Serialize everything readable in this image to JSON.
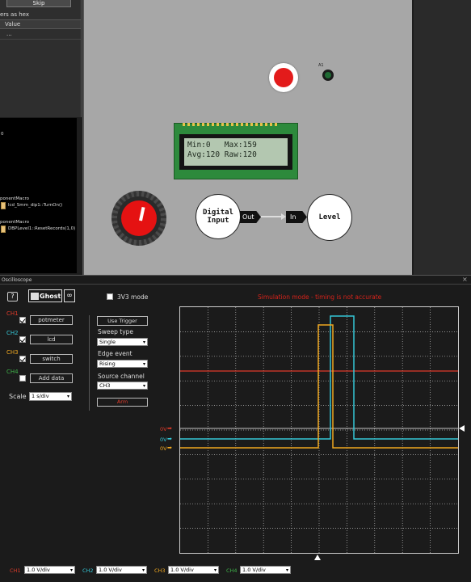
{
  "sim": {
    "skip_label": "Skip",
    "hex_label": "ers as hex",
    "value_header": "Value",
    "value_row": "...",
    "left_items": [
      {
        "text": "0"
      },
      {
        "text": "ponentMacro"
      },
      {
        "text": "lcd_Smm_dip1::TurnOn()"
      },
      {
        "text": "ponentMacro"
      },
      {
        "text": "DBPLevel1::ResetRecords(1,0)"
      }
    ]
  },
  "canvas": {
    "led_label": "A1",
    "lcd_line1": "Min:0   Max:159",
    "lcd_line2": "Avg:120 Raw:120",
    "digital_input": "Digital Input",
    "out_label": "Out",
    "in_label": "In",
    "level_label": "Level"
  },
  "scope": {
    "title": "Oscilloscope",
    "ghost_label": "Ghost",
    "mode_3v3": "3V3 mode",
    "warning": "Simulation mode - timing is not accurate",
    "channels": [
      {
        "id": "CH1",
        "name": "potmeter",
        "checked": true,
        "color": "#e03b2a"
      },
      {
        "id": "CH2",
        "name": "lcd",
        "checked": true,
        "color": "#35c8d8"
      },
      {
        "id": "CH3",
        "name": "switch",
        "checked": true,
        "color": "#f0a820"
      },
      {
        "id": "CH4",
        "name": "Add data",
        "checked": false,
        "color": "#3fb24a"
      }
    ],
    "scale_label": "Scale",
    "scale_value": "1 s/div",
    "trigger_btn": "Use Trigger",
    "sweep_label": "Sweep type",
    "sweep_value": "Single",
    "edge_label": "Edge event",
    "edge_value": "Rising",
    "source_label": "Source channel",
    "source_value": "CH3",
    "arm_btn": "Arm",
    "zero_labels": [
      "0V",
      "0V",
      "0V"
    ],
    "vdiv": [
      {
        "id": "CH1",
        "value": "1.0 V/div"
      },
      {
        "id": "CH2",
        "value": "1.0 V/div"
      },
      {
        "id": "CH3",
        "value": "1.0 V/div"
      },
      {
        "id": "CH4",
        "value": "1.0 V/div"
      }
    ]
  }
}
